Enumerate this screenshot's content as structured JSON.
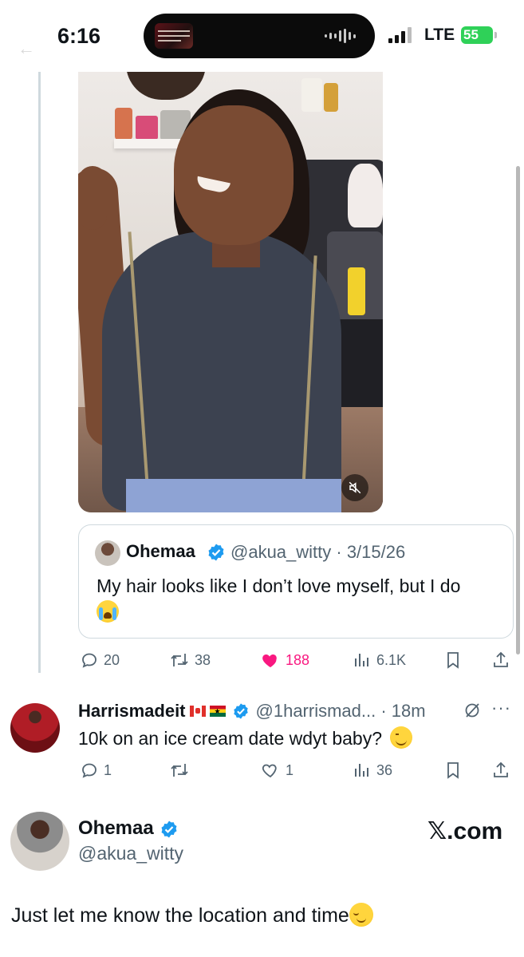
{
  "status_bar": {
    "time": "6:16",
    "network": "LTE",
    "battery": "55"
  },
  "quoted_post": {
    "name": "Ohemaa",
    "handle_date": "@akua_witty · 3/15/26",
    "text": "My hair looks like I don’t love myself, but I do"
  },
  "quote_actions": {
    "replies": "20",
    "reposts": "38",
    "likes": "188",
    "views": "6.1K"
  },
  "reply": {
    "name": "Harrismadeit",
    "handle_time": "@1harrismad... · 18m",
    "text": "10k on an ice cream date wdyt baby?",
    "replies": "1",
    "reposts": "",
    "likes": "1",
    "views": "36"
  },
  "main_post": {
    "name": "Ohemaa",
    "handle": "@akua_witty",
    "text": "Just let me know the location and time",
    "watermark": "𝕏.com"
  },
  "colors": {
    "text_primary": "#0f1419",
    "text_secondary": "#536471",
    "like_pink": "#f91880",
    "verified_blue": "#1d9bf0",
    "battery_green": "#2fd158",
    "border": "#cfd9de"
  },
  "icons": [
    "reply-icon",
    "repost-icon",
    "like-icon",
    "views-icon",
    "bookmark-icon",
    "share-icon",
    "verified-icon",
    "mute-icon",
    "grok-icon",
    "more-icon"
  ]
}
